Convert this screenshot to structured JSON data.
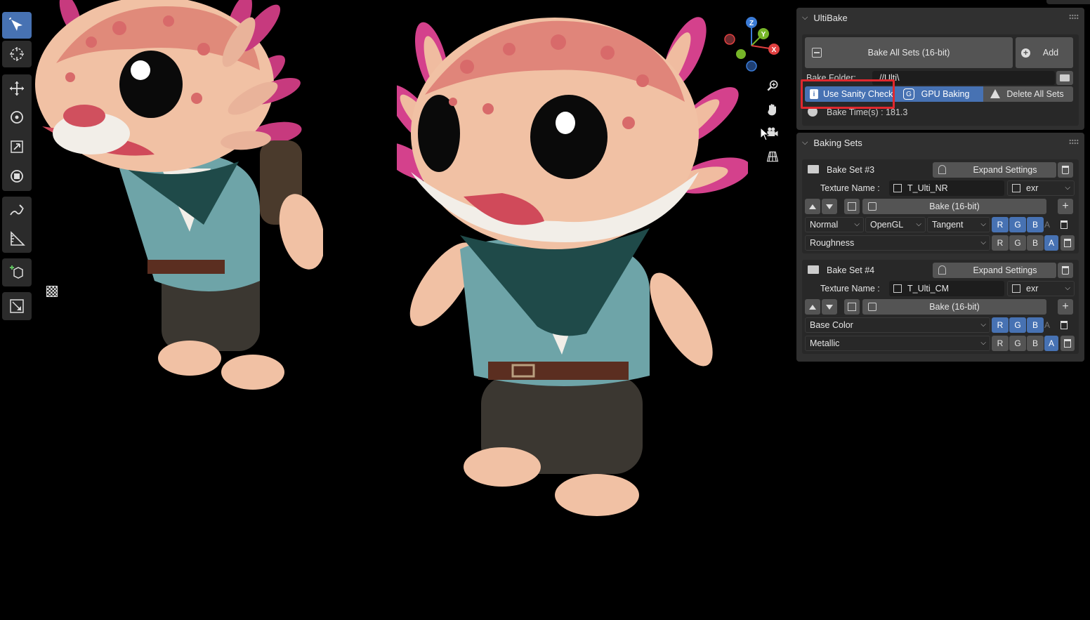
{
  "viewport": {
    "background": "#000000",
    "tools": [
      {
        "name": "select-box-tool",
        "icon": "cursor-select-icon",
        "active": true
      },
      {
        "name": "cursor-tool",
        "icon": "3d-cursor-icon",
        "active": false
      },
      {
        "name": "move-tool",
        "icon": "move-arrows-icon",
        "active": false
      },
      {
        "name": "rotate-tool",
        "icon": "rotate-icon",
        "active": false
      },
      {
        "name": "scale-tool",
        "icon": "scale-icon",
        "active": false
      },
      {
        "name": "transform-tool",
        "icon": "transform-icon",
        "active": false
      },
      {
        "name": "annotate-tool",
        "icon": "pencil-icon",
        "active": false
      },
      {
        "name": "measure-tool",
        "icon": "ruler-icon",
        "active": false
      },
      {
        "name": "add-cube-tool",
        "icon": "add-cube-icon",
        "active": false
      },
      {
        "name": "uv-tool",
        "icon": "uv-square-icon",
        "active": false
      }
    ],
    "gizmo_axes": {
      "x": "X",
      "y": "Y",
      "z": "Z"
    },
    "nav_buttons": [
      "zoom-icon",
      "hand-pan-icon",
      "camera-icon",
      "grid-perspective-icon"
    ]
  },
  "ultibake": {
    "title": "UltiBake",
    "bake_all_label": "Bake All Sets (16-bit)",
    "add_label": "Add",
    "bake_folder_label": "Bake Folder:",
    "bake_folder_value": "//Ulti\\",
    "sanity_check_label": "Use Sanity Check",
    "gpu_baking_label": "GPU Baking",
    "delete_all_label": "Delete All Sets",
    "bake_time_label": "Bake Time(s) : 181.3",
    "highlight_color": "#e0282e"
  },
  "baking_sets": {
    "title": "Baking Sets",
    "sets": [
      {
        "name": "Bake Set #3",
        "expand_label": "Expand Settings",
        "texture_label": "Texture Name :",
        "texture_value": "T_Ulti_NR",
        "format": "exr",
        "bake_label": "Bake (16-bit)",
        "row1": {
          "map": "Normal",
          "space": "OpenGL",
          "mode": "Tangent",
          "channels": [
            "R",
            "G",
            "B",
            "A"
          ],
          "active": [
            true,
            true,
            true,
            false
          ]
        },
        "row2": {
          "map": "Roughness",
          "channels": [
            "R",
            "G",
            "B",
            "A"
          ],
          "active": [
            false,
            false,
            false,
            true
          ]
        }
      },
      {
        "name": "Bake Set #4",
        "expand_label": "Expand Settings",
        "texture_label": "Texture Name :",
        "texture_value": "T_Ulti_CM",
        "format": "exr",
        "bake_label": "Bake (16-bit)",
        "row1": {
          "map": "Base Color",
          "channels": [
            "R",
            "G",
            "B",
            "A"
          ],
          "active": [
            true,
            true,
            true,
            false
          ]
        },
        "row2": {
          "map": "Metallic",
          "channels": [
            "R",
            "G",
            "B",
            "A"
          ],
          "active": [
            false,
            false,
            false,
            true
          ]
        }
      }
    ]
  }
}
